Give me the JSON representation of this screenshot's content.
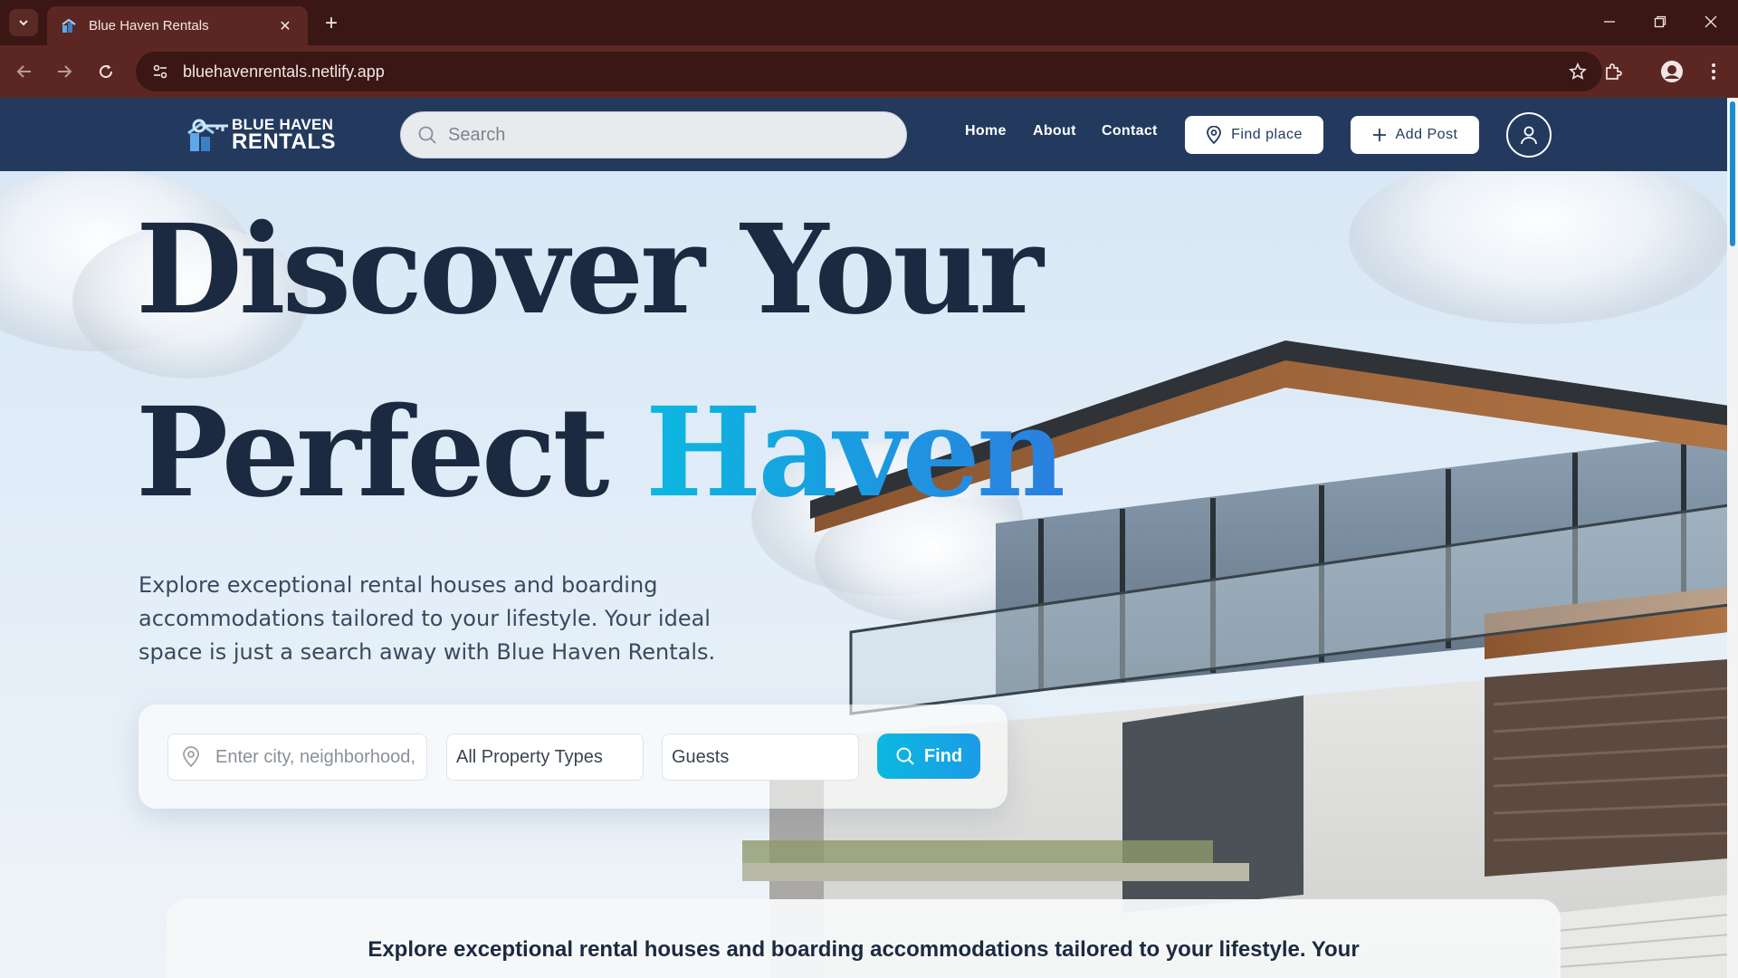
{
  "browser": {
    "tab_title": "Blue Haven Rentals",
    "url": "bluehavenrentals.netlify.app"
  },
  "site": {
    "logo": {
      "line1": "BLUE HAVEN",
      "line2": "RENTALS"
    },
    "search_placeholder": "Search",
    "nav": {
      "home": "Home",
      "about": "About",
      "contact": "Contact"
    },
    "buttons": {
      "find_place": "Find place",
      "add_post": "Add Post"
    }
  },
  "hero": {
    "title_line1": "Discover Your",
    "title_line2_plain": "Perfect",
    "title_line2_accent": "Haven",
    "description": "Explore exceptional rental houses and boarding accommodations tailored to your lifestyle. Your ideal space is just a search away with Blue Haven Rentals."
  },
  "search_panel": {
    "location_placeholder": "Enter city, neighborhood,",
    "property_type": "All Property Types",
    "guests": "Guests",
    "find_label": "Find"
  },
  "bottom_card": {
    "text": "Explore exceptional rental houses and boarding accommodations tailored to your lifestyle. Your"
  },
  "colors": {
    "nav_bg": "#233a5e",
    "accent": "#19a9e2",
    "heading": "#1b2a40",
    "browser_frame": "#3a1714"
  }
}
